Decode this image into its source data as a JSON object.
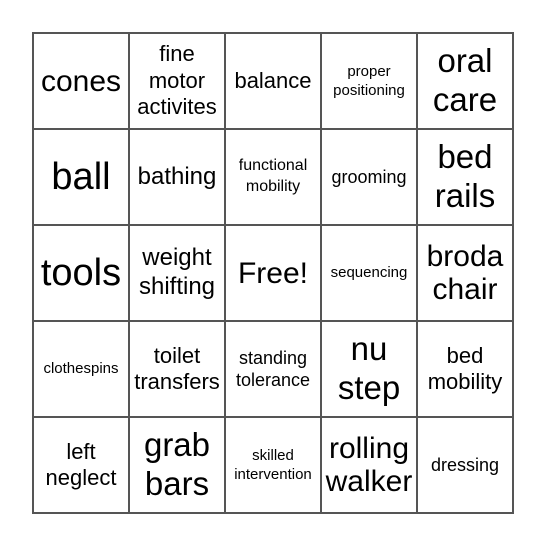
{
  "board": {
    "rows": [
      [
        {
          "text": "cones",
          "size": "l"
        },
        {
          "text": "fine\nmotor\nactivites",
          "size": "ms"
        },
        {
          "text": "balance",
          "size": "ms"
        },
        {
          "text": "proper\npositioning",
          "size": "xxs"
        },
        {
          "text": "oral\ncare",
          "size": "lb"
        }
      ],
      [
        {
          "text": "ball",
          "size": "xl"
        },
        {
          "text": "bathing",
          "size": "m"
        },
        {
          "text": "functional\nmobility",
          "size": "xs"
        },
        {
          "text": "grooming",
          "size": "s"
        },
        {
          "text": "bed\nrails",
          "size": "lb"
        }
      ],
      [
        {
          "text": "tools",
          "size": "xl"
        },
        {
          "text": "weight\nshifting",
          "size": "m"
        },
        {
          "text": "Free!",
          "size": "l"
        },
        {
          "text": "sequencing",
          "size": "xxs"
        },
        {
          "text": "broda\nchair",
          "size": "l"
        }
      ],
      [
        {
          "text": "clothespins",
          "size": "xxs"
        },
        {
          "text": "toilet\ntransfers",
          "size": "ms"
        },
        {
          "text": "standing\ntolerance",
          "size": "s"
        },
        {
          "text": "nu\nstep",
          "size": "lb"
        },
        {
          "text": "bed\nmobility",
          "size": "ms"
        }
      ],
      [
        {
          "text": "left\nneglect",
          "size": "ms"
        },
        {
          "text": "grab\nbars",
          "size": "lb"
        },
        {
          "text": "skilled\nintervention",
          "size": "xxs"
        },
        {
          "text": "rolling\nwalker",
          "size": "l"
        },
        {
          "text": "dressing",
          "size": "s"
        }
      ]
    ]
  }
}
